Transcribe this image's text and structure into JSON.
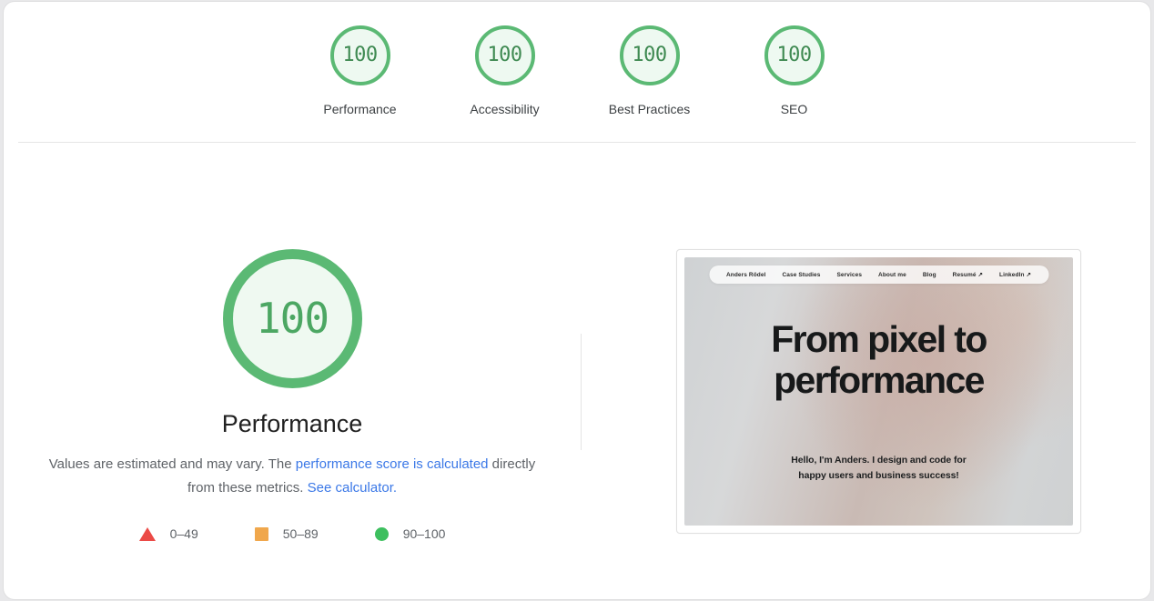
{
  "report": {
    "top_scores": [
      {
        "value": "100",
        "label": "Performance",
        "gauge_icon": "score-gauge-icon"
      },
      {
        "value": "100",
        "label": "Accessibility",
        "gauge_icon": "score-gauge-icon"
      },
      {
        "value": "100",
        "label": "Best Practices",
        "gauge_icon": "score-gauge-icon"
      },
      {
        "value": "100",
        "label": "SEO",
        "gauge_icon": "score-gauge-icon"
      }
    ],
    "category": {
      "score": "100",
      "title": "Performance",
      "description_part1": "Values are estimated and may vary. The ",
      "link1": "performance score is calculated",
      "description_part2": " directly from these metrics. ",
      "link2": "See calculator."
    },
    "legend": [
      {
        "marker": "triangle-fail-icon",
        "label": "0–49",
        "color": "#eb4a46"
      },
      {
        "marker": "square-average-icon",
        "label": "50–89",
        "color": "#f0a74c"
      },
      {
        "marker": "circle-pass-icon",
        "label": "90–100",
        "color": "#3dbf5e"
      }
    ],
    "colors": {
      "pass": "#5bb974",
      "pass_fill": "#eef9f1",
      "average": "#f0a74c",
      "fail": "#eb4a46",
      "link": "#3b78e7",
      "text": "#3c4043",
      "muted": "#5f6368"
    }
  },
  "screenshot": {
    "nav_items": [
      "Anders Rödel",
      "Case Studies",
      "Services",
      "About me",
      "Blog",
      "Resumé ↗",
      "LinkedIn ↗"
    ],
    "hero_title_line1": "From pixel to",
    "hero_title_line2": "performance",
    "hero_sub_line1": "Hello, I'm Anders. I design and code for",
    "hero_sub_line2": "happy users and business success!"
  }
}
